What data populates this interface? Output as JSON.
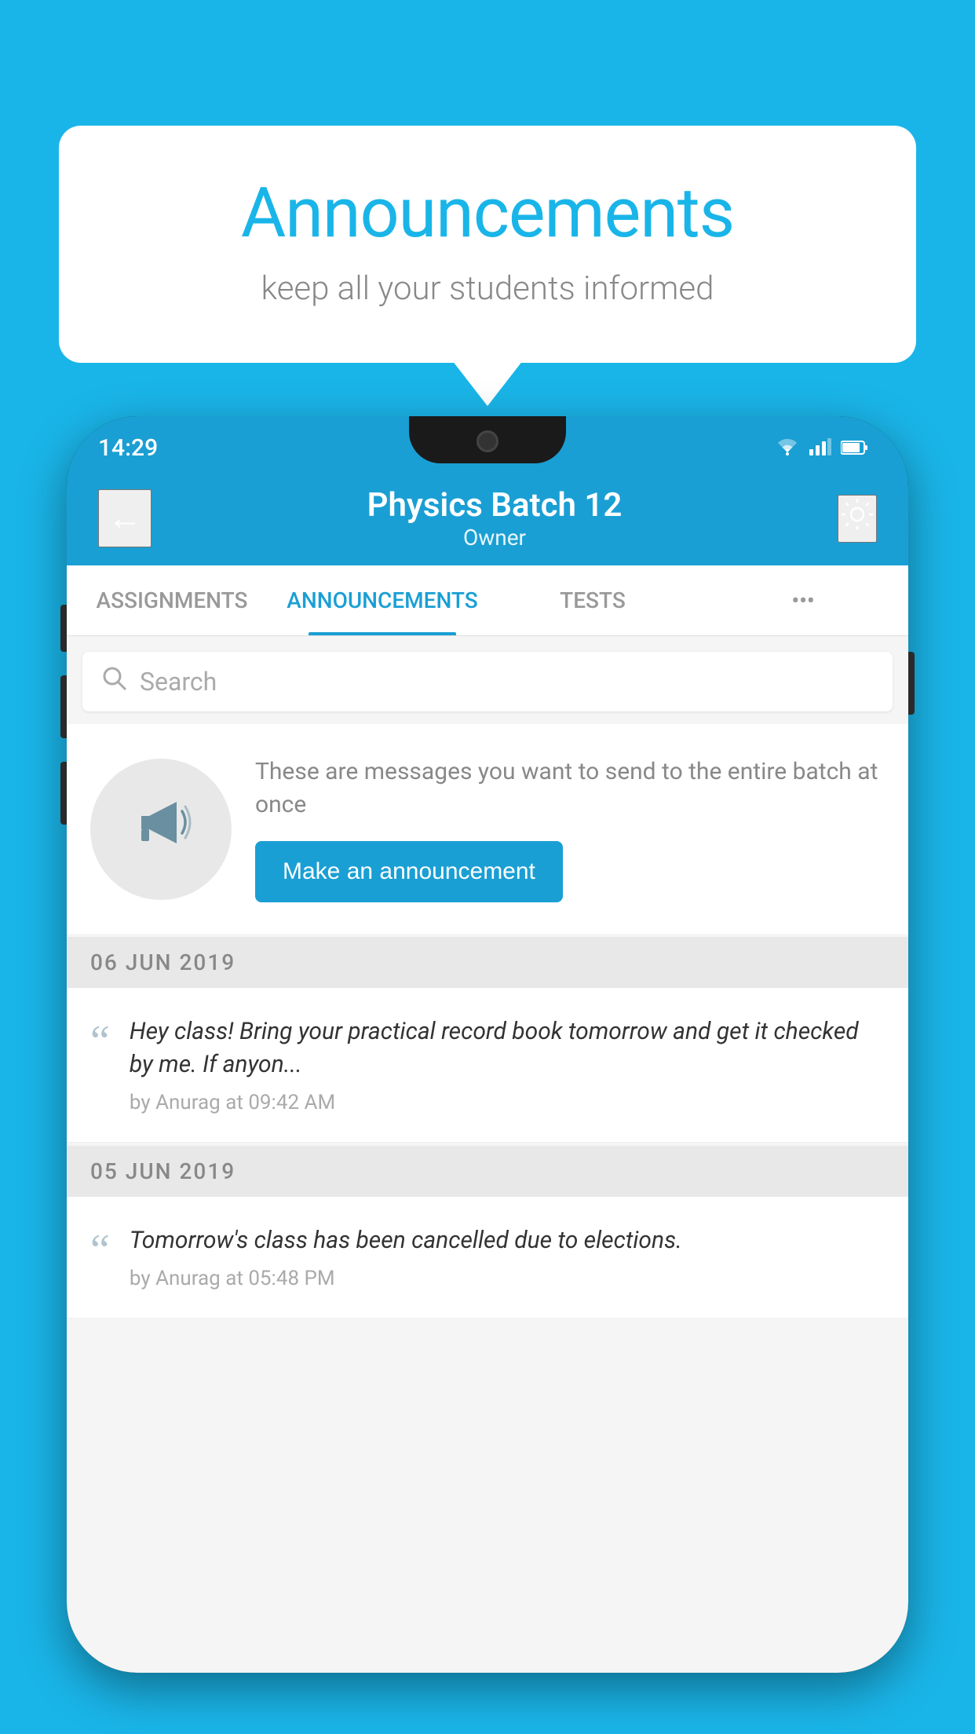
{
  "speech_bubble": {
    "title": "Announcements",
    "subtitle": "keep all your students informed"
  },
  "status_bar": {
    "time": "14:29",
    "wifi_icon": "wifi",
    "signal_icon": "signal",
    "battery_icon": "battery"
  },
  "app_bar": {
    "back_label": "←",
    "title": "Physics Batch 12",
    "subtitle": "Owner",
    "settings_label": "⚙"
  },
  "tabs": [
    {
      "label": "ASSIGNMENTS",
      "active": false
    },
    {
      "label": "ANNOUNCEMENTS",
      "active": true
    },
    {
      "label": "TESTS",
      "active": false
    },
    {
      "label": "•••",
      "active": false
    }
  ],
  "search": {
    "placeholder": "Search"
  },
  "promo_card": {
    "description": "These are messages you want to send to the entire batch at once",
    "button_label": "Make an announcement"
  },
  "announcements": [
    {
      "date": "06  JUN  2019",
      "message": "Hey class! Bring your practical record book tomorrow and get it checked by me. If anyon...",
      "meta": "by Anurag at 09:42 AM"
    },
    {
      "date": "05  JUN  2019",
      "message": "Tomorrow's class has been cancelled due to elections.",
      "meta": "by Anurag at 05:48 PM"
    }
  ],
  "colors": {
    "primary": "#1a9fd4",
    "background": "#1ab5e8",
    "text_dark": "#333",
    "text_muted": "#888",
    "tab_active": "#1a9fd4"
  }
}
